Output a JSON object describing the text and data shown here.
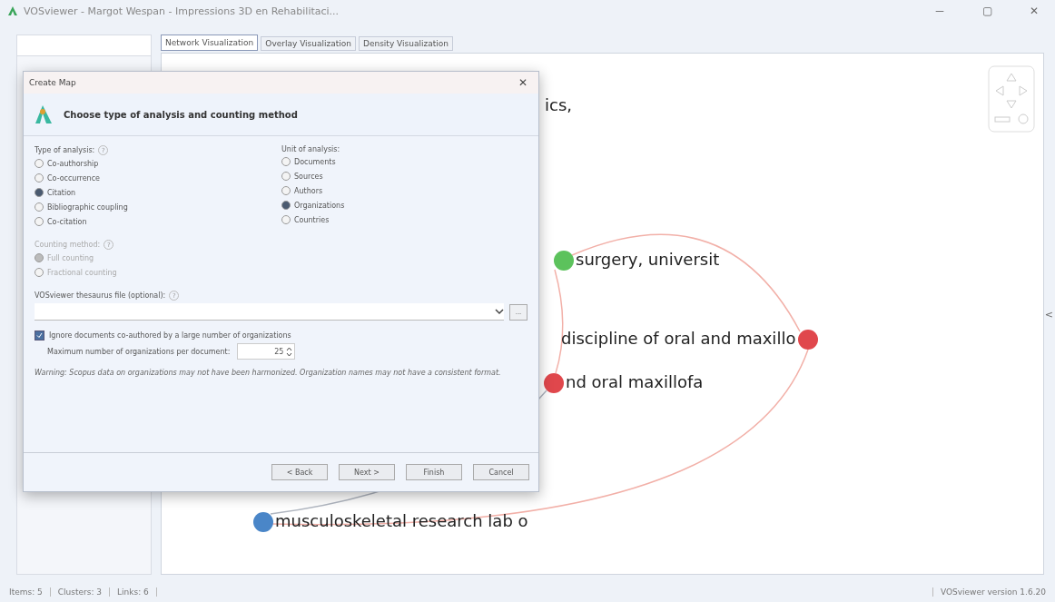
{
  "window": {
    "title": "VOSviewer - Margot Wespan - Impressions 3D en Rehabilitaci...",
    "controls": [
      "─",
      "▢",
      "✕"
    ]
  },
  "tabs": [
    {
      "label": "Network Visualization",
      "selected": true
    },
    {
      "label": "Overlay Visualization",
      "selected": false
    },
    {
      "label": "Density Visualization",
      "selected": false
    }
  ],
  "map": {
    "nodes": [
      {
        "label": "ics,"
      },
      {
        "label": "surgery, universit",
        "color": "#5cc25c"
      },
      {
        "label": "discipline of oral and maxillo",
        "color": "#e0474c"
      },
      {
        "label": "nd oral maxillofa",
        "color": "#e0474c"
      },
      {
        "label": "musculoskeletal research lab o",
        "color": "#4a86c8"
      }
    ],
    "side_toggle": "<"
  },
  "dialog": {
    "title": "Create Map",
    "close": "✕",
    "heading": "Choose type of analysis and counting method",
    "groups": [
      {
        "label": "Type of analysis:",
        "help": "?",
        "disabled": false,
        "options": [
          {
            "label": "Co-authorship",
            "selected": false
          },
          {
            "label": "Co-occurrence",
            "selected": false
          },
          {
            "label": "Citation",
            "selected": true
          },
          {
            "label": "Bibliographic coupling",
            "selected": false
          },
          {
            "label": "Co-citation",
            "selected": false
          }
        ]
      },
      {
        "label": "Unit of analysis:",
        "disabled": false,
        "options": [
          {
            "label": "Documents",
            "selected": false
          },
          {
            "label": "Sources",
            "selected": false
          },
          {
            "label": "Authors",
            "selected": false
          },
          {
            "label": "Organizations",
            "selected": true
          },
          {
            "label": "Countries",
            "selected": false
          }
        ]
      },
      {
        "label": "Counting method:",
        "help": "?",
        "disabled": true,
        "options": [
          {
            "label": "Full counting",
            "selected": true
          },
          {
            "label": "Fractional counting",
            "selected": false
          }
        ]
      }
    ],
    "thesaurus": {
      "label": "VOSviewer thesaurus file (optional):",
      "help": "?",
      "browse": "..."
    },
    "ignore": {
      "label": "Ignore documents co-authored by a large number of organizations",
      "checked": true
    },
    "max": {
      "label": "Maximum number of organizations per document:",
      "value": "25"
    },
    "warning": "Warning: Scopus data on organizations may not have been harmonized. Organization names may not have a consistent format.",
    "buttons": [
      "< Back",
      "Next >",
      "Finish",
      "Cancel"
    ]
  },
  "status_bar": {
    "left": [
      "Items: 5",
      "Clusters: 3",
      "Links: 6"
    ],
    "right": "VOSviewer version 1.6.20"
  }
}
